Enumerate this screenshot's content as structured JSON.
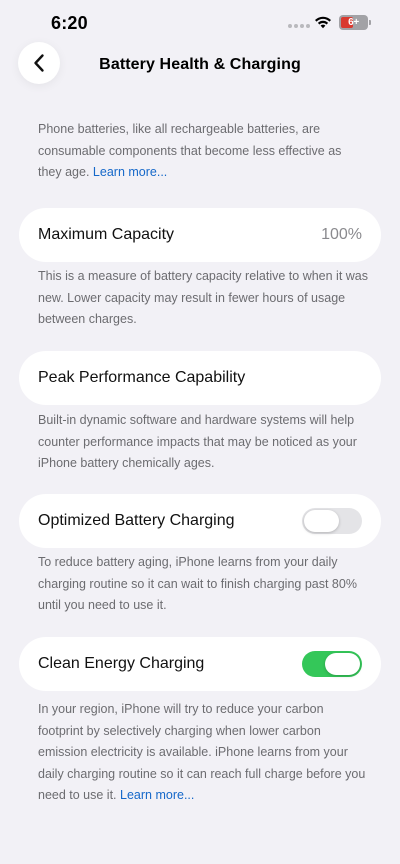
{
  "status_bar": {
    "time": "6:20",
    "battery_label": "6+"
  },
  "header": {
    "title": "Battery Health & Charging"
  },
  "intro": {
    "text": "Phone batteries, like all rechargeable batteries, are consumable components that become less effective as they age.",
    "link": "Learn more..."
  },
  "maximum_capacity": {
    "label": "Maximum Capacity",
    "value": "100%",
    "note": "This is a measure of battery capacity relative to when it was new. Lower capacity may result in fewer hours of usage between charges."
  },
  "peak_performance": {
    "label": "Peak Performance Capability",
    "note": "Built-in dynamic software and hardware systems will help counter performance impacts that may be noticed as your iPhone battery chemically ages."
  },
  "optimized_charging": {
    "label": "Optimized Battery Charging",
    "enabled": false,
    "note": "To reduce battery aging, iPhone learns from your daily charging routine so it can wait to finish charging past 80% until you need to use it."
  },
  "clean_energy": {
    "label": "Clean Energy Charging",
    "enabled": true,
    "note": "In your region, iPhone will try to reduce your carbon footprint by selectively charging when lower carbon emission electricity is available. iPhone learns from your daily charging routine so it can reach full charge before you need to use it.",
    "link": "Learn more..."
  },
  "colors": {
    "background": "#f2f1f6",
    "link": "#1568c9",
    "toggle_on": "#34c759",
    "toggle_off": "#e4e4e7",
    "secondary_text": "#6c6c70"
  }
}
